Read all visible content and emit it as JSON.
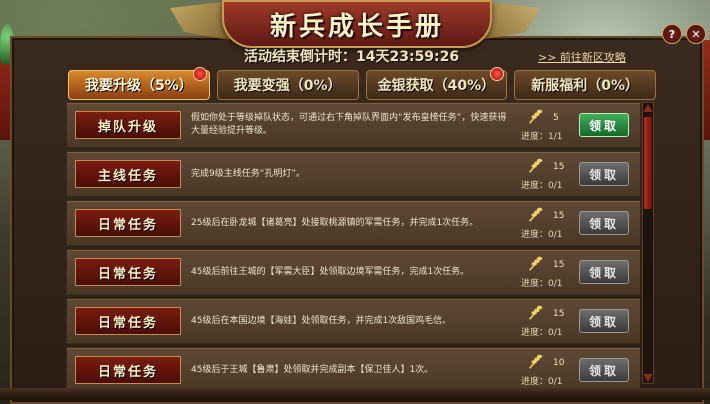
{
  "title": "新兵成长手册",
  "countdown": "活动结束倒计时：14天23:59:26",
  "goto_link": ">> 前往新区攻略",
  "top_icons": {
    "help": "?",
    "close": "✕"
  },
  "tabs": [
    {
      "label": "我要升级（5%）",
      "active": true,
      "badge": true
    },
    {
      "label": "我要变强（0%）",
      "active": false,
      "badge": false
    },
    {
      "label": "金银获取（40%）",
      "active": false,
      "badge": true
    },
    {
      "label": "新服福利（0%）",
      "active": false,
      "badge": false
    }
  ],
  "progress_label": "进度：",
  "rows": [
    {
      "task": "掉队升级",
      "desc": "假如你处于等级掉队状态，可通过右下角掉队界面内“发布皇榜任务”，快速获得大量经验提升等级。",
      "reward": "5",
      "progress": "1/1",
      "button": "领取",
      "ready": true
    },
    {
      "task": "主线任务",
      "desc": "完成9级主线任务“孔明灯”。",
      "reward": "15",
      "progress": "0/1",
      "button": "领取",
      "ready": false
    },
    {
      "task": "日常任务",
      "desc": "25级后在卧龙城【诸葛亮】处接取桃源镇的军需任务，并完成1次任务。",
      "reward": "15",
      "progress": "0/1",
      "button": "领取",
      "ready": false
    },
    {
      "task": "日常任务",
      "desc": "45级后前往王城的【军需大臣】处领取边境军需任务，完成1次任务。",
      "reward": "15",
      "progress": "0/1",
      "button": "领取",
      "ready": false
    },
    {
      "task": "日常任务",
      "desc": "45级后在本国边境【海娃】处领取任务，并完成1次敌国鸡毛信。",
      "reward": "15",
      "progress": "0/1",
      "button": "领取",
      "ready": false
    },
    {
      "task": "日常任务",
      "desc": "45级后于王城【鲁肃】处领取并完成副本【保卫佳人】1次。",
      "reward": "10",
      "progress": "0/1",
      "button": "领取",
      "ready": false
    }
  ]
}
